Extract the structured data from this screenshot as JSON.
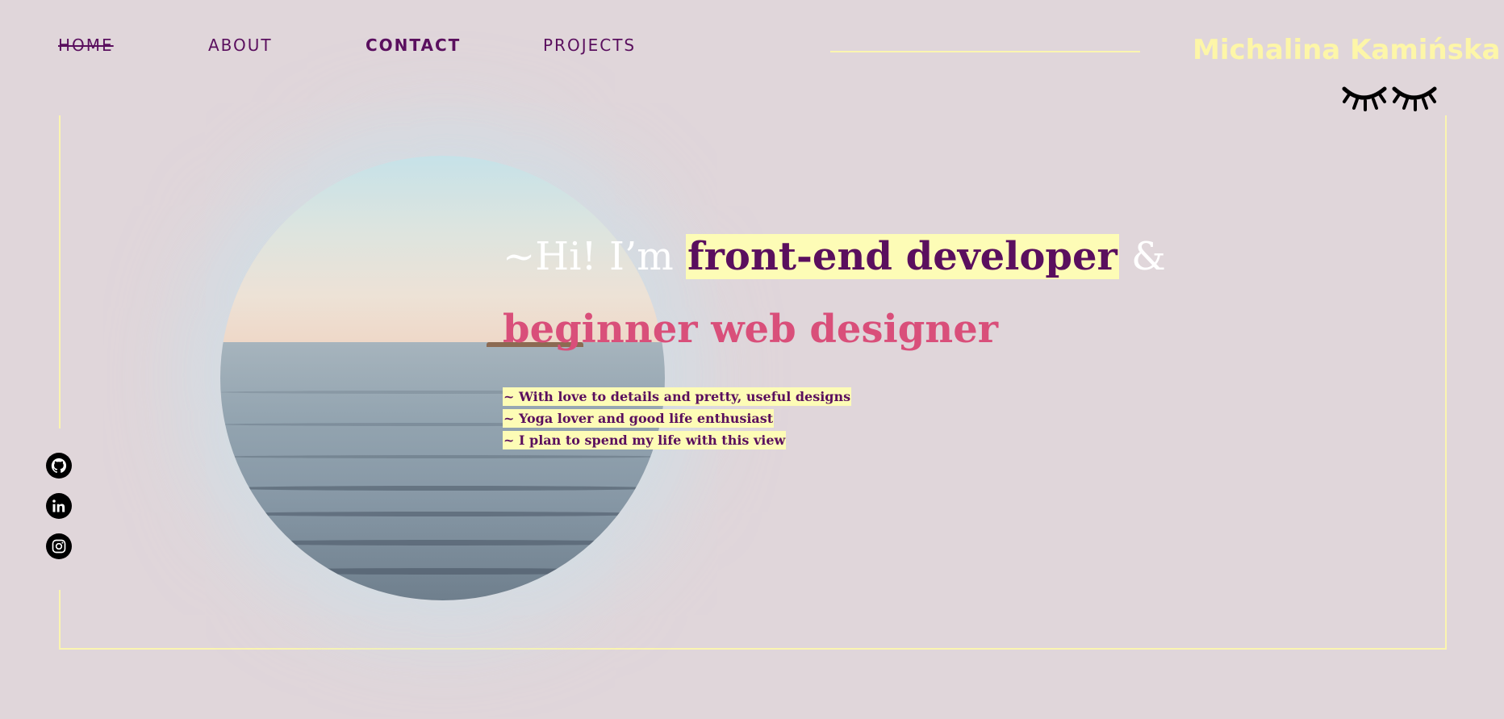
{
  "nav": {
    "items": [
      {
        "label": "Home",
        "active": true
      },
      {
        "label": "About"
      },
      {
        "label": "Contact"
      },
      {
        "label": "Projects"
      }
    ]
  },
  "brand": {
    "name": "Michalina Kamińska"
  },
  "hero": {
    "greeting": "~Hi! I’m",
    "role": "front-end developer",
    "ampersand": "&",
    "subtitle": "beginner web designer",
    "bullets": [
      "~ With love to details and pretty, useful designs",
      "~ Yoga lover and good life enthusiast",
      "~ I plan to spend my life with this view"
    ]
  },
  "social": [
    {
      "icon": "github-icon"
    },
    {
      "icon": "linkedin-icon"
    },
    {
      "icon": "instagram-icon"
    }
  ],
  "colors": {
    "background": "#e0d6da",
    "accent_purple": "#5a0f5e",
    "accent_pink": "#d94f7a",
    "accent_yellow": "#fdf6a8"
  }
}
